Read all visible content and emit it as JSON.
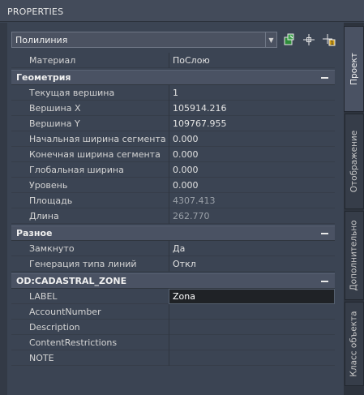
{
  "title": "PROPERTIES",
  "selector": {
    "value": "Полилиния"
  },
  "toolbar": {
    "icons": [
      "quick-select-icon",
      "select-objects-icon",
      "toggle-pickadd-icon"
    ]
  },
  "general": [
    {
      "name": "Материал",
      "value": "ПоСлою"
    }
  ],
  "categories": [
    {
      "title": "Геометрия",
      "rows": [
        {
          "name": "Текущая вершина",
          "value": "1"
        },
        {
          "name": "Вершина X",
          "value": "105914.216"
        },
        {
          "name": "Вершина Y",
          "value": "109767.955"
        },
        {
          "name": "Начальная ширина сегмента",
          "value": "0.000"
        },
        {
          "name": "Конечная ширина сегмента",
          "value": "0.000"
        },
        {
          "name": "Глобальная ширина",
          "value": "0.000"
        },
        {
          "name": "Уровень",
          "value": "0.000"
        },
        {
          "name": "Площадь",
          "value": "4307.413"
        },
        {
          "name": "Длина",
          "value": "262.770"
        }
      ]
    },
    {
      "title": "Разное",
      "rows": [
        {
          "name": "Замкнуто",
          "value": "Да"
        },
        {
          "name": "Генерация типа линий",
          "value": "Откл"
        }
      ]
    },
    {
      "title": "OD:CADASTRAL_ZONE",
      "rows": [
        {
          "name": "LABEL",
          "value": "Zona"
        },
        {
          "name": "AccountNumber",
          "value": ""
        },
        {
          "name": "Description",
          "value": ""
        },
        {
          "name": "ContentRestrictions",
          "value": ""
        },
        {
          "name": "NOTE",
          "value": ""
        }
      ]
    }
  ],
  "tabs": [
    {
      "label": "Проект"
    },
    {
      "label": "Отображение"
    },
    {
      "label": "Дополнительно"
    },
    {
      "label": "Класс объекта"
    }
  ]
}
